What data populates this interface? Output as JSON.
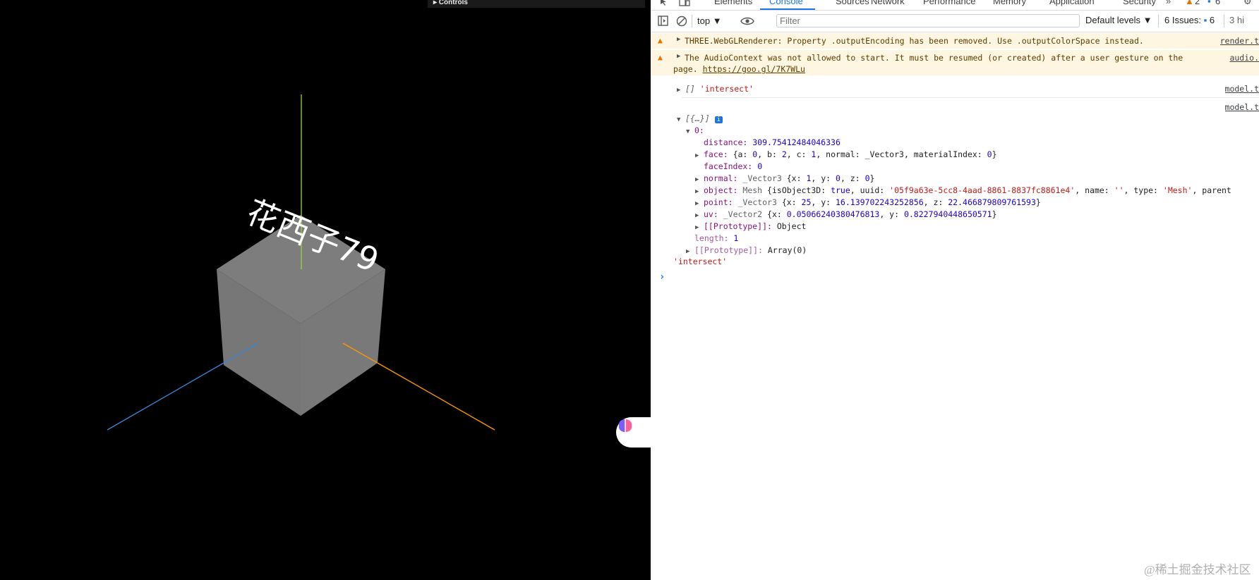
{
  "scene": {
    "label_text": "花西子79",
    "controls_label": "▸ Controls",
    "colors": {
      "cube": "#7b7b7b",
      "axis_x": "#ff9900",
      "axis_y": "#9bd33d",
      "axis_z": "#3a86d6"
    }
  },
  "devtools": {
    "tabs": [
      "Elements",
      "Console",
      "Sources",
      "Network",
      "Performance",
      "Memory",
      "Application",
      "Security"
    ],
    "active_tab": "Console",
    "badges": {
      "warnings": "2",
      "messages": "6"
    },
    "toolbar": {
      "context": "top",
      "filter_placeholder": "Filter",
      "levels": "Default levels",
      "issues_label": "6 Issues:",
      "issues_count": "6",
      "hidden": "3 hi"
    },
    "messages": {
      "warn1": {
        "text": "THREE.WebGLRenderer: Property .outputEncoding has been removed. Use .outputColorSpace instead.",
        "source": "render.t"
      },
      "warn2": {
        "text_a": "The AudioContext was not allowed to start. It must be resumed (or created) after a user gesture on the",
        "text_b": "page.",
        "link": "https://goo.gl/7K7WLu",
        "source": "audio."
      },
      "log1": {
        "array": "[]",
        "string": "'intersect'",
        "source": "model.t"
      },
      "log2": {
        "source": "model.t",
        "header": "[{…}]",
        "index_key": "0:",
        "distance_key": "distance:",
        "distance_val": "309.75412484046336",
        "face_key": "face:",
        "face_val_a": "{a: ",
        "face_a": "0",
        "face_val_b": ", b: ",
        "face_b": "2",
        "face_val_c": ", c: ",
        "face_c": "1",
        "face_val_d": ", normal: _Vector3, materialIndex: ",
        "face_d": "0",
        "face_val_e": "}",
        "faceindex_key": "faceIndex:",
        "faceindex_val": "0",
        "normal_key": "normal:",
        "normal_type": "_Vector3",
        "normal_val_a": "{x: ",
        "normal_x": "1",
        "normal_val_b": ", y: ",
        "normal_y": "0",
        "normal_val_c": ", z: ",
        "normal_z": "0",
        "normal_val_d": "}",
        "object_key": "object:",
        "object_type": "Mesh",
        "object_val_a": "{isObject3D: ",
        "object_true": "true",
        "object_val_b": ", uuid: ",
        "object_uuid": "'05f9a63e-5cc8-4aad-8861-8837fc8861e4'",
        "object_val_c": ", name: ",
        "object_name": "''",
        "object_val_d": ", type: ",
        "object_typestr": "'Mesh'",
        "object_val_e": ", parent",
        "point_key": "point:",
        "point_type": "_Vector3",
        "point_val_a": "{x: ",
        "point_x": "25",
        "point_val_b": ", y: ",
        "point_y": "16.139702243252856",
        "point_val_c": ", z: ",
        "point_z": "22.466879809761593",
        "point_val_d": "}",
        "uv_key": "uv:",
        "uv_type": "_Vector2",
        "uv_val_a": "{x: ",
        "uv_x": "0.05066240380476813",
        "uv_val_b": ", y: ",
        "uv_y": "0.8227940448650571",
        "uv_val_c": "}",
        "proto_obj_key": "[[Prototype]]:",
        "proto_obj_val": "Object",
        "length_key": "length:",
        "length_val": "1",
        "proto_arr_key": "[[Prototype]]:",
        "proto_arr_val": "Array(0)"
      },
      "log3": {
        "string": "'intersect'"
      },
      "prompt": "›"
    }
  },
  "watermark": "@稀土掘金技术社区"
}
